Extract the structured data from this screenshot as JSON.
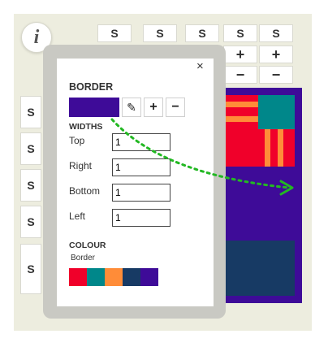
{
  "info_label": "i",
  "columns": [
    "S",
    "S",
    "S",
    "S",
    "S"
  ],
  "column_plus": [
    "+",
    "+",
    "+",
    "+",
    "+"
  ],
  "column_minus": [
    "−",
    "−"
  ],
  "rows": [
    "S",
    "S",
    "S",
    "S",
    "S"
  ],
  "row_plus": [
    "+",
    "+",
    "+",
    "+",
    "+"
  ],
  "popup": {
    "close_label": "×",
    "border_heading": "BORDER",
    "border_color": "#3e0b98",
    "edit_label": "✎",
    "add_label": "+",
    "remove_label": "−",
    "widths_heading": "WIDTHS",
    "widths": [
      {
        "label": "Top",
        "value": "1"
      },
      {
        "label": "Right",
        "value": "1"
      },
      {
        "label": "Bottom",
        "value": "1"
      },
      {
        "label": "Left",
        "value": "1"
      }
    ],
    "colour_heading": "COLOUR",
    "colour_sub": "Border",
    "palette": [
      "#f0002a",
      "#00878a",
      "#ff8c38",
      "#173a64",
      "#3e0b98"
    ]
  },
  "canvas_colors": {
    "background": "#3e0b98",
    "red": "#f0002a",
    "teal": "#00878a",
    "orange": "#ff8c38",
    "navy": "#173a64",
    "arrow": "#23b823"
  }
}
